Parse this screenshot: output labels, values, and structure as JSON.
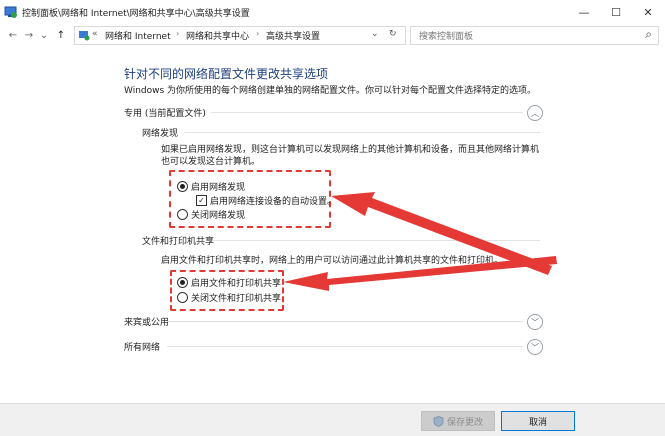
{
  "window": {
    "title": "控制面板\\网络和 Internet\\网络和共享中心\\高级共享设置",
    "minimize": "—",
    "maximize": "☐",
    "close": "✕"
  },
  "nav": {
    "back": "←",
    "forward": "→",
    "recent": "⌄",
    "up": "↑",
    "chevrons": "«",
    "dropdown": "⌄",
    "refresh": "↻",
    "crumbs": [
      "网络和 Internet",
      "网络和共享中心",
      "高级共享设置"
    ],
    "separator": "›"
  },
  "search": {
    "placeholder": "搜索控制面板",
    "icon": "⌕"
  },
  "main": {
    "heading": "针对不同的网络配置文件更改共享选项",
    "description": "Windows 为你所使用的每个网络创建单独的网络配置文件。你可以针对每个配置文件选择特定的选项。",
    "private_profile": {
      "label": "专用 (当前配置文件)",
      "network_discovery": {
        "title": "网络发现",
        "text": "如果已启用网络发现，则这台计算机可以发现网络上的其他计算机和设备，而且其他网络计算机也可以发现这台计算机。",
        "on_label": "启用网络发现",
        "auto_setup_label": "启用网络连接设备的自动设置。",
        "off_label": "关闭网络发现",
        "selected": "on",
        "auto_setup_checked": true
      },
      "file_printer": {
        "title": "文件和打印机共享",
        "text": "启用文件和打印机共享时，网络上的用户可以访问通过此计算机共享的文件和打印机。",
        "on_label": "启用文件和打印机共享",
        "off_label": "关闭文件和打印机共享",
        "selected": "on"
      }
    },
    "guest_profile": {
      "label": "来宾或公用"
    },
    "all_networks": {
      "label": "所有网络"
    }
  },
  "footer": {
    "save_label": "保存更改",
    "cancel_label": "取消"
  },
  "colors": {
    "heading": "#1e3f80",
    "annotation_red": "#e53935",
    "accent": "#0078d7"
  }
}
